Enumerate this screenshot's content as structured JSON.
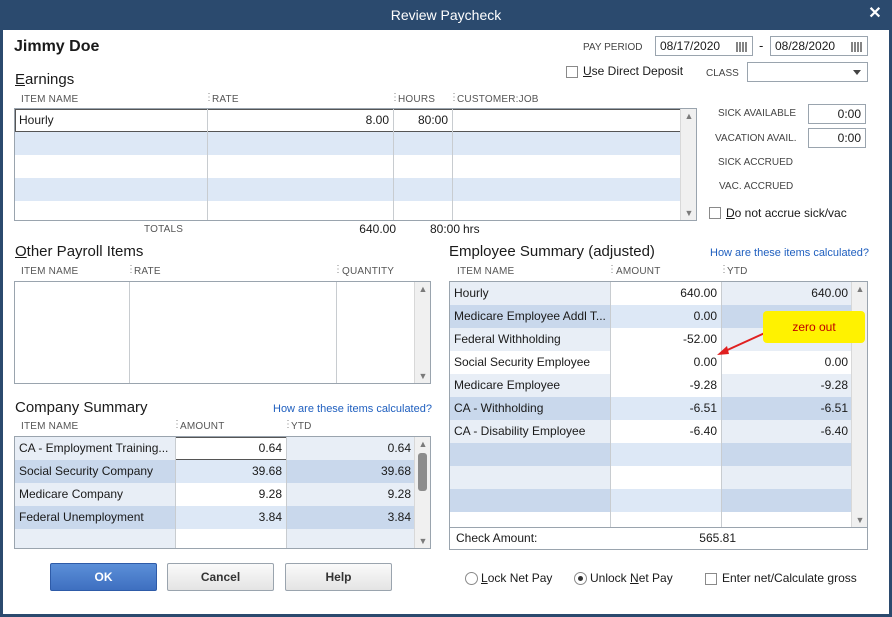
{
  "window": {
    "title": "Review Paycheck"
  },
  "employee": {
    "name": "Jimmy Doe"
  },
  "pay_period": {
    "label": "PAY PERIOD",
    "start": "08/17/2020",
    "separator": "-",
    "end": "08/28/2020"
  },
  "direct_deposit": {
    "label_u": "U",
    "label_rest": "se Direct Deposit",
    "checked": false
  },
  "class_field": {
    "label": "CLASS",
    "value": ""
  },
  "earnings": {
    "title_u": "E",
    "title_rest": "arnings",
    "headers": [
      "ITEM NAME",
      "RATE",
      "HOURS",
      "CUSTOMER:JOB"
    ],
    "rows": [
      {
        "item": "Hourly",
        "rate": "8.00",
        "hours": "80:00",
        "job": ""
      }
    ],
    "totals": {
      "label": "TOTALS",
      "amount": "640.00",
      "hours": "80:00",
      "unit": "hrs"
    }
  },
  "sick_vacation": {
    "sick_available": {
      "label": "SICK AVAILABLE",
      "value": "0:00"
    },
    "vacation_avail": {
      "label": "VACATION AVAIL.",
      "value": "0:00"
    },
    "sick_accrued": {
      "label": "SICK ACCRUED"
    },
    "vac_accrued": {
      "label": "VAC. ACCRUED"
    },
    "no_accrue": {
      "label_u": "D",
      "label_rest": "o not accrue sick/vac",
      "checked": false
    }
  },
  "other_payroll": {
    "title_u": "O",
    "title_rest": "ther Payroll Items",
    "headers": [
      "ITEM NAME",
      "RATE",
      "QUANTITY"
    ]
  },
  "employee_summary": {
    "title": "Employee Summary (adjusted)",
    "link": "How are these items calculated?",
    "headers": [
      "ITEM NAME",
      "AMOUNT",
      "YTD"
    ],
    "rows": [
      {
        "item": "Hourly",
        "amount": "640.00",
        "ytd": "640.00"
      },
      {
        "item": "Medicare Employee Addl T...",
        "amount": "0.00",
        "ytd": ""
      },
      {
        "item": "Federal Withholding",
        "amount": "-52.00",
        "ytd": ""
      },
      {
        "item": "Social Security Employee",
        "amount": "0.00",
        "ytd": "0.00"
      },
      {
        "item": "Medicare Employee",
        "amount": "-9.28",
        "ytd": "-9.28"
      },
      {
        "item": "CA - Withholding",
        "amount": "-6.51",
        "ytd": "-6.51"
      },
      {
        "item": "CA - Disability Employee",
        "amount": "-6.40",
        "ytd": "-6.40"
      }
    ],
    "check_amount": {
      "label": "Check Amount:",
      "value": "565.81"
    }
  },
  "annotation": {
    "text": "zero out",
    "bg": "#fff200",
    "fg": "#c00000"
  },
  "company_summary": {
    "title": "Company Summary",
    "link": "How are these items calculated?",
    "headers": [
      "ITEM NAME",
      "AMOUNT",
      "YTD"
    ],
    "rows": [
      {
        "item": "CA - Employment Training...",
        "amount": "0.64",
        "ytd": "0.64"
      },
      {
        "item": "Social Security Company",
        "amount": "39.68",
        "ytd": "39.68"
      },
      {
        "item": "Medicare Company",
        "amount": "9.28",
        "ytd": "9.28"
      },
      {
        "item": "Federal Unemployment",
        "amount": "3.84",
        "ytd": "3.84"
      }
    ]
  },
  "buttons": {
    "ok": "OK",
    "cancel": "Cancel",
    "help": "Help"
  },
  "net_pay": {
    "lock": {
      "label_pre": "",
      "label_u": "L",
      "label_rest": "ock Net Pay",
      "selected": false
    },
    "unlock": {
      "label_pre": "Unlock ",
      "label_u": "N",
      "label_rest": "et Pay",
      "selected": true
    },
    "enter_net": {
      "label_pre": "Enter net/Calculate ",
      "label_u": "g",
      "label_rest": "ross",
      "checked": false
    }
  },
  "colors": {
    "title_bar": "#2b4a6e",
    "row_alt": "#dde8f6",
    "primary_button": "#3e6fc0",
    "link": "#1f5fbf"
  }
}
